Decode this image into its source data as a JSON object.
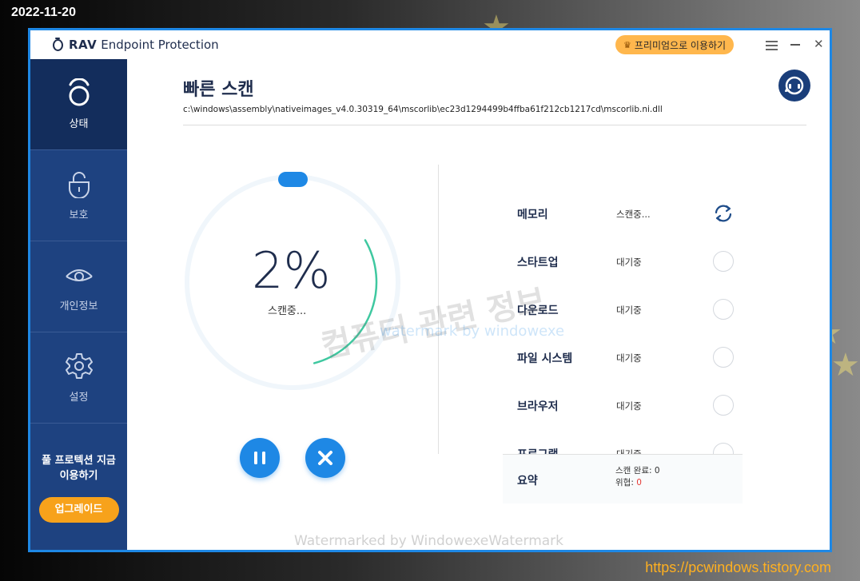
{
  "desktop": {
    "date": "2022-11-20",
    "site_url": "https://pcwindows.tistory.com"
  },
  "titlebar": {
    "brand_name": "RAV",
    "brand_sub": "Endpoint Protection",
    "premium_label": "프리미엄으로 이용하기",
    "accent_color": "#1e88e5"
  },
  "sidebar": {
    "items": [
      {
        "label": "상태",
        "icon": "status-icon"
      },
      {
        "label": "보호",
        "icon": "lock-icon"
      },
      {
        "label": "개인정보",
        "icon": "eye-icon"
      },
      {
        "label": "설정",
        "icon": "gear-icon"
      }
    ],
    "promo_line1": "풀 프로텍션 지금",
    "promo_line2": "이용하기",
    "upgrade_label": "업그레이드"
  },
  "scan": {
    "title": "빠른 스캔",
    "current_path": "c:\\windows\\assembly\\nativeimages_v4.0.30319_64\\mscorlib\\ec23d1294499b4ffba61f212cb1217cd\\mscorlib.ni.dll",
    "progress_text": "2%",
    "progress_value": 0.02,
    "progress_label": "스캔중...",
    "items": [
      {
        "name": "메모리",
        "status": "스캔중...",
        "state": "scanning"
      },
      {
        "name": "스타트업",
        "status": "대기중",
        "state": "waiting"
      },
      {
        "name": "다운로드",
        "status": "대기중",
        "state": "waiting"
      },
      {
        "name": "파일 시스템",
        "status": "대기중",
        "state": "waiting"
      },
      {
        "name": "브라우저",
        "status": "대기중",
        "state": "waiting"
      },
      {
        "name": "프로그램",
        "status": "대기중",
        "state": "waiting"
      }
    ],
    "summary": {
      "label": "요약",
      "scanned_label": "스캔 완료:",
      "scanned_value": "0",
      "threat_label": "위협:",
      "threat_value": "0"
    }
  },
  "watermarks": {
    "korean": "컴퓨터 관련 정보",
    "english_small": "watermark by windowexe",
    "bottom": "Watermarked by WindowexeWatermark"
  }
}
